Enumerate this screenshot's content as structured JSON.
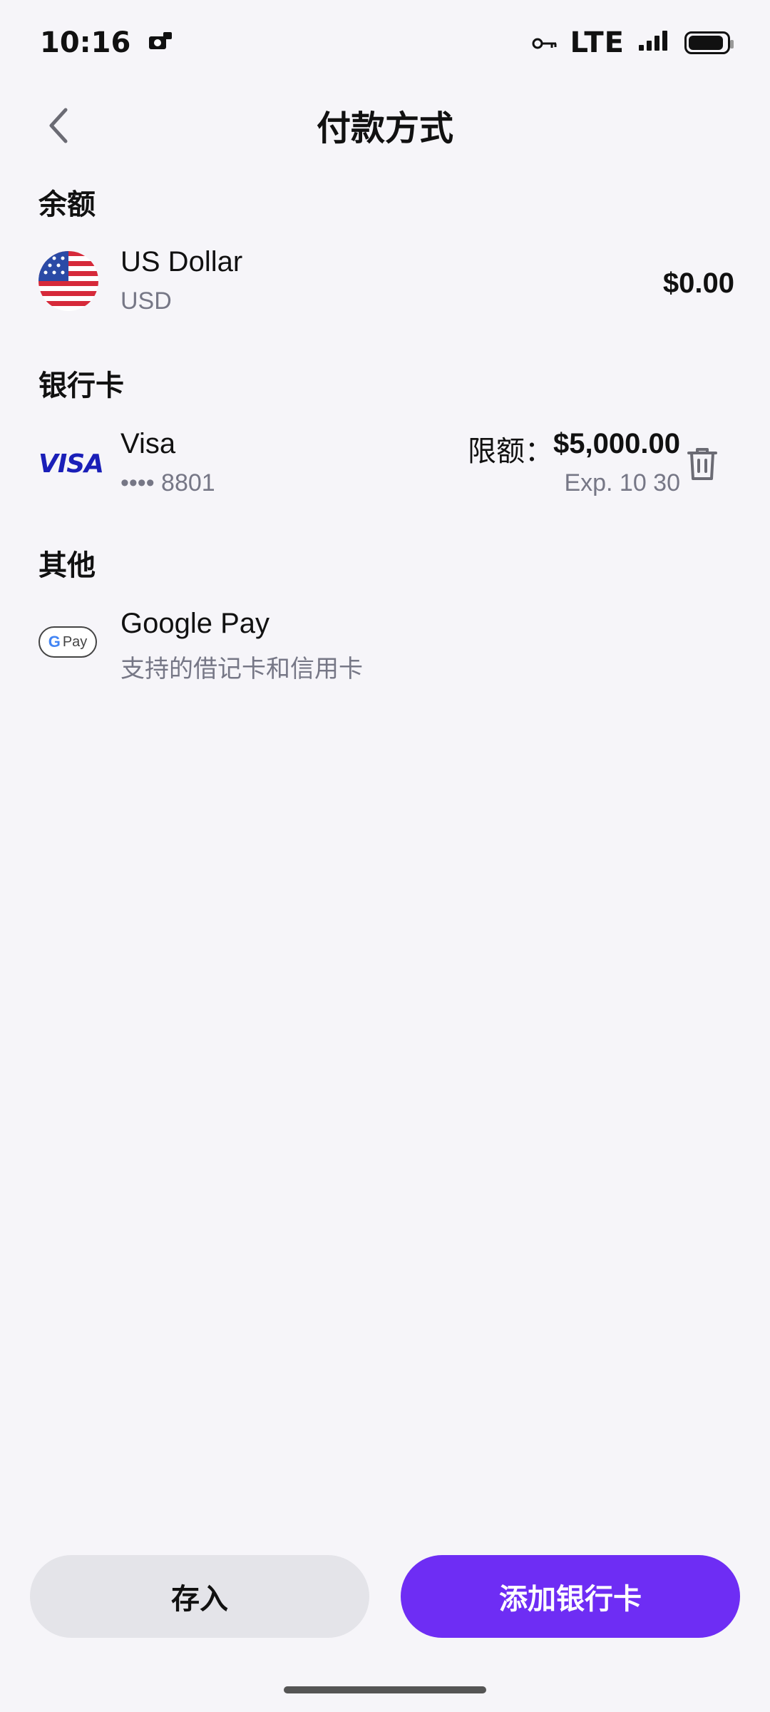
{
  "status_bar": {
    "time": "10:16",
    "network": "LTE",
    "icons": [
      "camera-badge-icon",
      "key-icon",
      "signal-icon",
      "battery-icon"
    ]
  },
  "header": {
    "title": "付款方式",
    "back_icon": "chevron-left-icon"
  },
  "balance": {
    "section_label": "余额",
    "currency_name": "US Dollar",
    "currency_code": "USD",
    "amount": "$0.00",
    "flag_icon": "us-flag-icon"
  },
  "bank_cards": {
    "section_label": "银行卡",
    "cards": [
      {
        "brand": "Visa",
        "brand_logo_text": "VISA",
        "masked_number": "•••• 8801",
        "limit_label": "限额：",
        "limit_value": "$5,000.00",
        "expiry": "Exp. 10 30",
        "delete_icon": "trash-icon"
      }
    ]
  },
  "other": {
    "section_label": "其他",
    "items": [
      {
        "name": "Google Pay",
        "description": "支持的借记卡和信用卡",
        "logo_g": "G",
        "logo_pay": "Pay"
      }
    ]
  },
  "actions": {
    "deposit_label": "存入",
    "add_card_label": "添加银行卡"
  },
  "colors": {
    "accent": "#6e2df4",
    "background": "#f6f5f9",
    "secondary_button": "#e4e4e9",
    "visa_blue": "#1a1fb8",
    "muted_text": "#767786"
  }
}
